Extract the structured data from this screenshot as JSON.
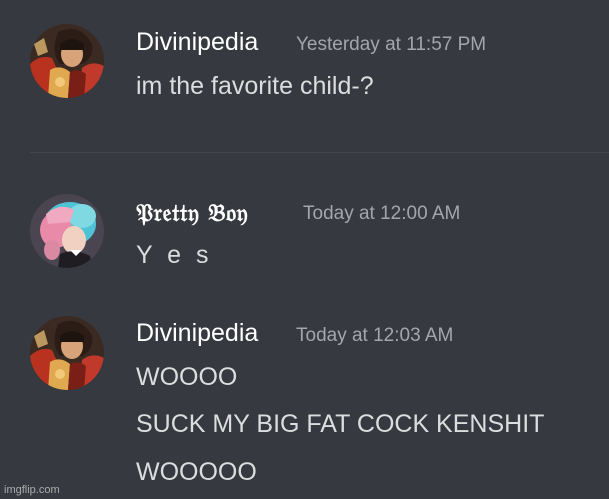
{
  "messages": [
    {
      "username": "Divinipedia",
      "timestamp": "Yesterday at 11:57 PM",
      "lines": [
        "im the favorite child-?"
      ],
      "avatar_icon": "armored-hero-avatar"
    },
    {
      "username": "𝔓𝔯𝔢𝔱𝔱𝔶 𝔅𝔬𝔶",
      "timestamp": "Today at 12:00 AM",
      "lines": [
        "Y e s"
      ],
      "avatar_icon": "pink-blue-hair-avatar"
    },
    {
      "username": "Divinipedia",
      "timestamp": "Today at 12:03 AM",
      "lines": [
        "WOOOO",
        "SUCK MY BIG FAT COCK KENSHIT",
        "WOOOOO"
      ],
      "avatar_icon": "armored-hero-avatar"
    }
  ],
  "watermark": "imgflip.com",
  "colors": {
    "background": "#36393f",
    "username": "#ffffff",
    "timestamp": "#a3a6aa",
    "message": "#dcddde"
  }
}
